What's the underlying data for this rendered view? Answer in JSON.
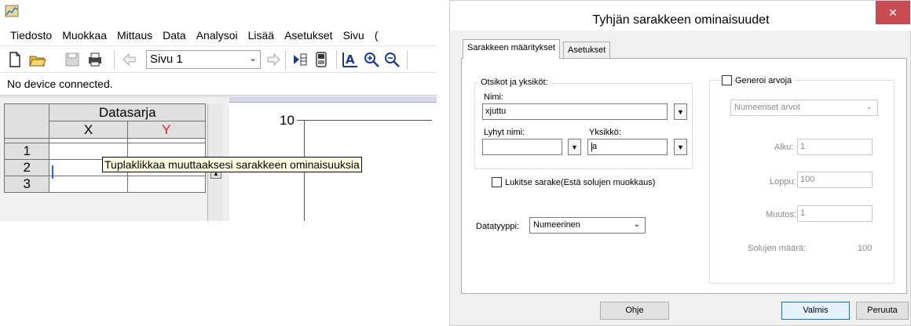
{
  "app": {
    "menu": [
      "Tiedosto",
      "Muokkaa",
      "Mittaus",
      "Data",
      "Analysoi",
      "Lisää",
      "Asetukset",
      "Sivu",
      "("
    ],
    "page_select": "Sivu 1",
    "status": "No device connected.",
    "table": {
      "dataset_title": "Datasarja",
      "col_x": "X",
      "col_y": "Y",
      "rows": [
        "1",
        "2",
        "3"
      ]
    },
    "graph": {
      "y_max_label": "10"
    },
    "tooltip": "Tuplaklikkaa muuttaaksesi sarakkeen ominaisuuksia",
    "colors": {
      "y_column": "#e0202a",
      "graph_header": "#d7d7ee"
    }
  },
  "dialog": {
    "title": "Tyhjän sarakkeen ominaisuudet",
    "close": "✕",
    "tabs": [
      "Sarakkeen määritykset",
      "Asetukset"
    ],
    "labels_group": {
      "legend": "Otsikot ja yksiköt:",
      "name_label": "Nimi:",
      "name_value": "xjuttu",
      "short_name_label": "Lyhyt nimi:",
      "short_name_value": "",
      "unit_label": "Yksikkö:",
      "unit_value": "a"
    },
    "lock_column": {
      "label": "Lukitse sarake(Estä solujen muokkaus)",
      "checked": false
    },
    "datatype": {
      "label": "Datatyyppi:",
      "value": "Numeerinen"
    },
    "generate": {
      "label": "Generoi arvoja",
      "checked": false,
      "type_value": "Numeeriset arvot",
      "start_label": "Alku:",
      "start_value": "1",
      "end_label": "Loppu:",
      "end_value": "100",
      "step_label": "Muutos:",
      "step_value": "1",
      "count_label": "Solujen määrä:",
      "count_value": "100"
    },
    "buttons": {
      "help": "Ohje",
      "ok": "Valmis",
      "cancel": "Peruuta"
    }
  }
}
